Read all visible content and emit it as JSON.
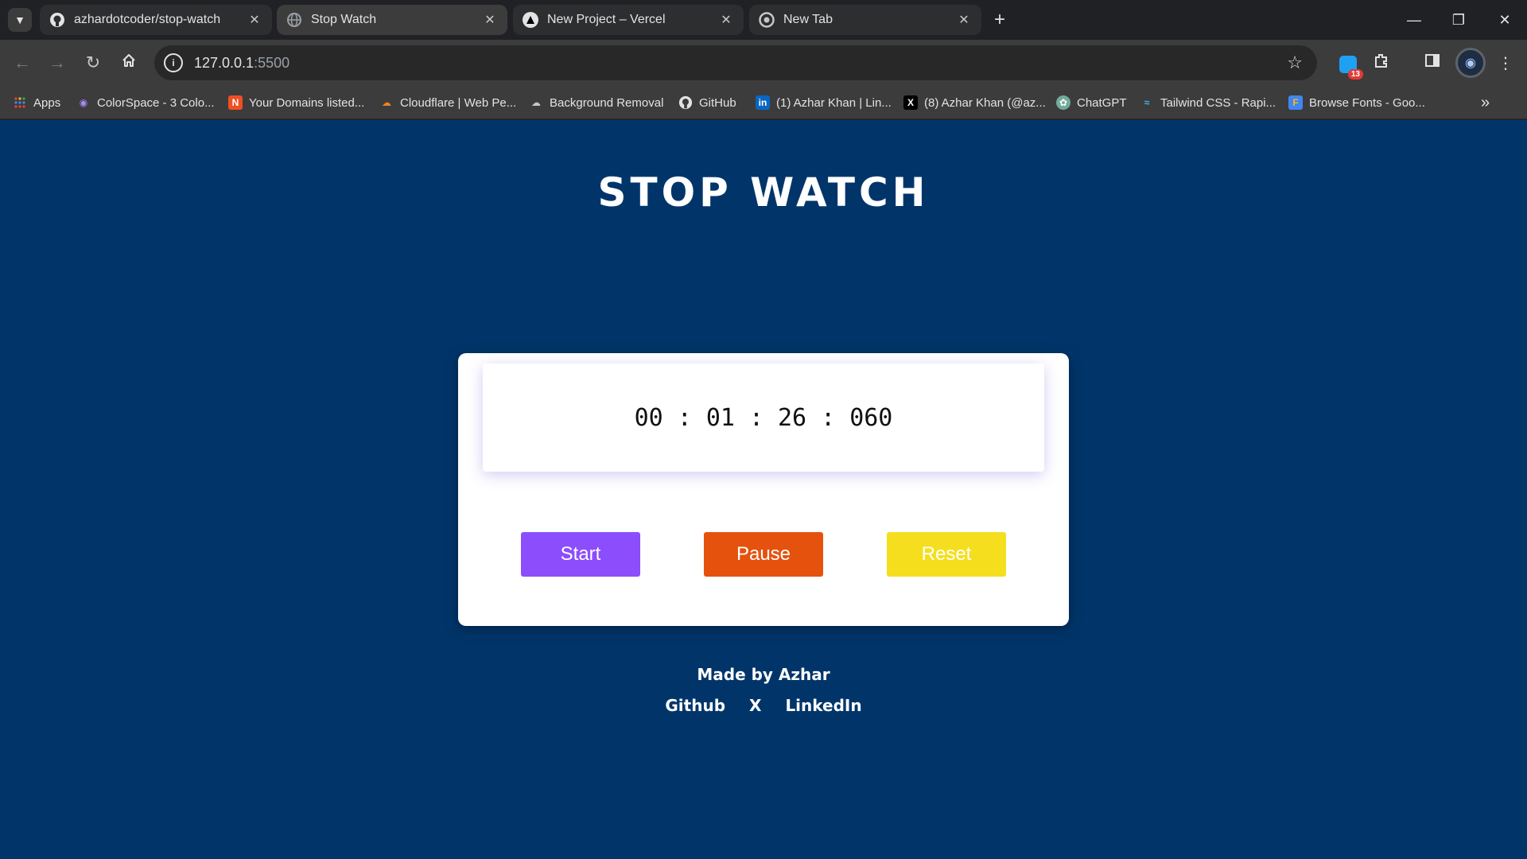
{
  "browser": {
    "tabs": [
      {
        "title": "azhardotcoder/stop-watch",
        "icon": "github-icon",
        "active": false
      },
      {
        "title": "Stop Watch",
        "icon": "globe-icon",
        "active": true
      },
      {
        "title": "New Project – Vercel",
        "icon": "vercel-icon",
        "active": false
      },
      {
        "title": "New Tab",
        "icon": "chrome-icon",
        "active": false
      }
    ],
    "address": {
      "host": "127.0.0.1",
      "port": ":5500"
    },
    "bookmarks": [
      {
        "label": "Apps",
        "icon": "apps-grid-icon"
      },
      {
        "label": "ColorSpace - 3 Colo...",
        "icon": "colorspace-icon"
      },
      {
        "label": "Your Domains listed...",
        "icon": "namecheap-icon"
      },
      {
        "label": "Cloudflare | Web Pe...",
        "icon": "cloudflare-icon"
      },
      {
        "label": "Background Removal",
        "icon": "cloud-icon"
      },
      {
        "label": "GitHub",
        "icon": "github-icon"
      },
      {
        "label": "(1) Azhar Khan | Lin...",
        "icon": "linkedin-icon"
      },
      {
        "label": "(8) Azhar Khan (@az...",
        "icon": "x-icon"
      },
      {
        "label": "ChatGPT",
        "icon": "chatgpt-icon"
      },
      {
        "label": "Tailwind CSS - Rapi...",
        "icon": "tailwind-icon"
      },
      {
        "label": "Browse Fonts - Goo...",
        "icon": "google-fonts-icon"
      }
    ],
    "extension_badge_count": "13"
  },
  "page": {
    "title": "STOP WATCH",
    "timer": {
      "hours": "00",
      "minutes": "01",
      "seconds": "26",
      "milliseconds": "060",
      "separator": ":"
    },
    "buttons": {
      "start": "Start",
      "pause": "Pause",
      "reset": "Reset"
    },
    "footer": {
      "made_by": "Made by Azhar",
      "links": [
        "Github",
        "X",
        "LinkedIn"
      ]
    }
  },
  "colors": {
    "page_background": "#01356a",
    "start": "#8c4dfd",
    "pause": "#e5520d",
    "reset": "#f5de1d"
  }
}
